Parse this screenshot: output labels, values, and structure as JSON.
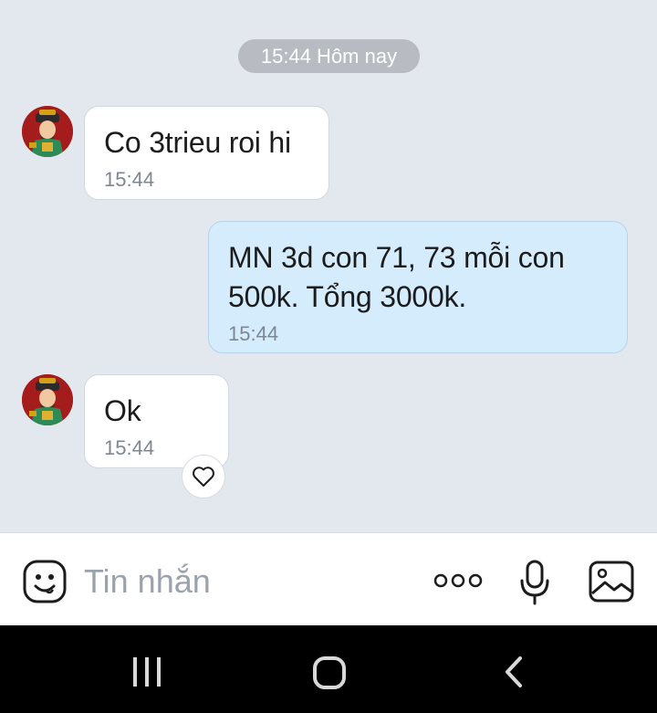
{
  "date_divider": "15:44 Hôm nay",
  "messages": [
    {
      "direction": "incoming",
      "text": "Co 3trieu roi hi",
      "time": "15:44"
    },
    {
      "direction": "outgoing",
      "text": "MN 3d con 71, 73 mỗi con 500k. Tổng 3000k.",
      "time": "15:44"
    },
    {
      "direction": "incoming",
      "text": "Ok",
      "time": "15:44",
      "reaction_icon": "heart-outline-icon"
    }
  ],
  "composer": {
    "placeholder": "Tin nhắn",
    "icons": [
      "sticker-smiley-icon",
      "more-dots-icon",
      "microphone-icon",
      "image-gallery-icon"
    ]
  },
  "system_nav": {
    "icons": [
      "recent-apps-icon",
      "home-icon",
      "back-icon"
    ]
  },
  "colors": {
    "chat_background": "#e3e8ef",
    "incoming_bubble": "#ffffff",
    "outgoing_bubble": "#d5ecfc",
    "timestamp": "#7d8794",
    "nav_bar": "#000000"
  }
}
